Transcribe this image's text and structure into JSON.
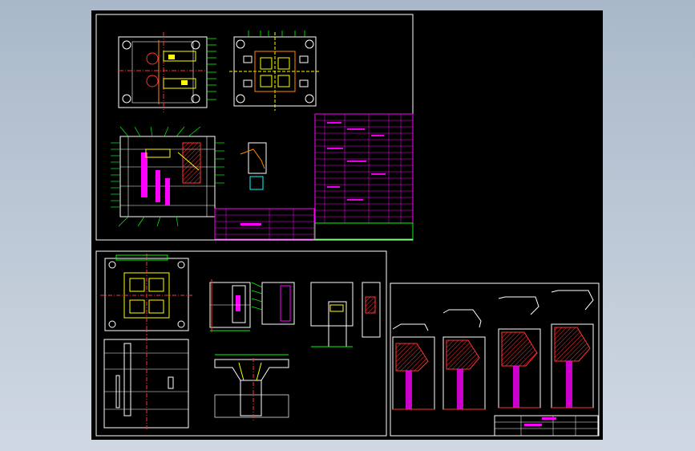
{
  "app": {
    "theme": "cad-dark"
  },
  "colors": {
    "background": "#000000",
    "frame": "#ffffff",
    "dimension": "#00ff00",
    "table": "#ff00ff",
    "highlight": "#ffff00",
    "hatch": "#ff3333",
    "section": "#00ffff",
    "orange": "#ff8800"
  },
  "sheets": [
    {
      "id": "sheet-top-left",
      "title": ""
    },
    {
      "id": "sheet-bottom-left",
      "title": ""
    },
    {
      "id": "sheet-bottom-right",
      "title": ""
    }
  ]
}
